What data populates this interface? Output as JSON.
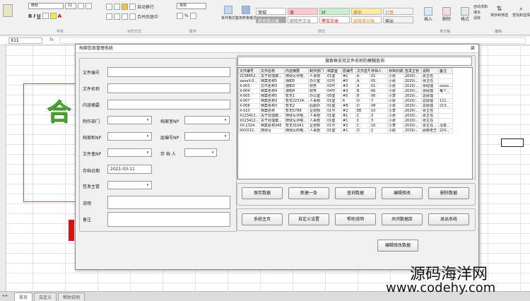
{
  "ribbon": {
    "font_name": "微软",
    "font_size": "11",
    "wrap_text": "自动换行",
    "number_format": "常规",
    "merge_center": "合并后居中",
    "percent": "%",
    "group_font": "字体",
    "group_align": "对齐方式",
    "group_number": "数字",
    "group_styles": "样式",
    "group_cells": "单元格",
    "group_edit": "编辑",
    "cond_format": "条件格式",
    "table_format": "套用表格格式",
    "styles": [
      {
        "label": "常规",
        "bg": "#ffffff",
        "fg": "#111111"
      },
      {
        "label": "差",
        "bg": "#ffc7ce",
        "fg": "#9c0006"
      },
      {
        "label": "好",
        "bg": "#c6efce",
        "fg": "#006100"
      },
      {
        "label": "适中",
        "bg": "#ffeb9c",
        "fg": "#9c6500"
      },
      {
        "label": "计算",
        "bg": "#f2f2f2",
        "fg": "#fa7d00"
      },
      {
        "label": "检查单元格",
        "bg": "#a5a5a5",
        "fg": "#ffffff"
      },
      {
        "label": "解释性文本",
        "bg": "#ffffff",
        "fg": "#7f7f7f"
      },
      {
        "label": "警告文本",
        "bg": "#ffffff",
        "fg": "#ff0000"
      },
      {
        "label": "链接单元格",
        "bg": "#ffffff",
        "fg": "#fa7d00"
      },
      {
        "label": "输出",
        "bg": "#f2f2f2",
        "fg": "#3f3f3f"
      }
    ],
    "insert": "插入",
    "delete": "删除",
    "format": "格式",
    "sort_filter": "排序和筛选",
    "find_select": "查找和选择",
    "autosum": "自动求和",
    "fill": "填充",
    "clear": "清除"
  },
  "formula_bar": {
    "cell_ref": "X11",
    "fx": "fx"
  },
  "sheet": {
    "big_char": "合",
    "tabs": [
      "首页",
      "自定义",
      "帮助说明"
    ]
  },
  "dialog": {
    "title": "档案信息管理系统",
    "close_glyph": "⊠",
    "fields": {
      "file_no": "文件编号",
      "file_name": "文件名称",
      "summary": "内容摘要",
      "dept": "制作部门",
      "cabinet": "档案室NP",
      "shelf": "档案柜NP",
      "layer": "层编号NP",
      "box": "文件盒NP",
      "keeper": "存 档 人",
      "date": "存档日期",
      "date_value": "2021-03-11",
      "leader": "签发主管",
      "note": "说明",
      "remark": "备注"
    },
    "search_hint": "搜索框支持文件名称的模糊查询",
    "columns": [
      "文件编号",
      "文件名称",
      "内容摘要",
      "制作部门",
      "档案室",
      "层编号",
      "文件盒号",
      "存档人",
      "存档日期",
      "签发主管",
      "说明",
      "备注"
    ],
    "rows": [
      [
        "2158652...",
        "关于处理旗...",
        "随便写点啥...",
        "人事部",
        "01室",
        "#1",
        "A",
        "01",
        "小张",
        "2020/...",
        "张主任",
        "",
        ""
      ],
      [
        "aaaaX-0...",
        "档案名称5",
        "通知5",
        "办公室",
        "02号",
        "#5",
        "A",
        "05",
        "小张",
        "2020/...",
        "张主任",
        "",
        ""
      ],
      [
        "X-003",
        "文件名称3",
        "通知3",
        "财务",
        "03号",
        "#3",
        "A",
        "01",
        "小张",
        "2020/...",
        "张经理",
        "sssss...",
        "ss12..."
      ],
      [
        "X-004",
        "档案名称4",
        "通知4",
        "财务",
        "04号",
        "#3",
        "B",
        "06",
        "小张",
        "2020/...",
        "张经理",
        "每个...",
        "hhh..."
      ],
      [
        "X-005",
        "档案名称5",
        "暂无1",
        "办公室",
        "05室",
        "#5",
        "B",
        "06",
        "小李",
        "2020/...",
        "总经理",
        "",
        ""
      ],
      [
        "X-007",
        "档案名称3",
        "暂无22314...",
        "人事部",
        "01室",
        "6",
        "D",
        "7",
        "小张",
        "2020/...",
        "总经理",
        "121...",
        "121..."
      ],
      [
        "X-008",
        "档案名称3",
        "暂无2",
        "后勤办",
        "01室",
        "#8",
        "D",
        "08",
        "小张",
        "2020/...",
        "总经理",
        "213...",
        "213..."
      ],
      [
        "X-010",
        "档案名称",
        "暂无5789",
        "企划部",
        "01号",
        "#2",
        "EE",
        "10",
        "小李",
        "2020/...",
        "张主任",
        "",
        ""
      ],
      [
        "X123412...",
        "关于处理旗...",
        "随便写点啥...",
        "人事部",
        "01室",
        "#1",
        "C",
        "3",
        "小张",
        "2020/...",
        "张主任",
        "",
        ""
      ],
      [
        "X123412...",
        "关于处理旗...",
        "随便写点啥...",
        "人事部",
        "01室",
        "#1",
        "C",
        "3",
        "小张",
        "2020/...",
        "张主任",
        "",
        ""
      ],
      [
        "XX-1324...",
        "档案名称345",
        "暂无31041",
        "企划部",
        "01号",
        "#2",
        "C",
        "10",
        "小李",
        "2020/...",
        "张主任...",
        "没有..."
      ],
      [
        "XXXX12...",
        "随便写",
        "随便写的哦...",
        "人事部",
        "01室",
        "#1",
        "D",
        "2",
        "小赵",
        "2020/...",
        "顾要老王",
        "22X...",
        "22X..."
      ]
    ],
    "buttons_row1": [
      "保存数据",
      "新建一条",
      "查询数据",
      "编辑修改",
      "删除数据"
    ],
    "buttons_row2": [
      "系统主页",
      "自定义设置",
      "帮助说明",
      "关闭数据库",
      "退出系统"
    ],
    "edit_button": "编辑修改数据"
  },
  "watermark": {
    "line1": "源码海洋网",
    "line2": "www.codehy.com"
  }
}
